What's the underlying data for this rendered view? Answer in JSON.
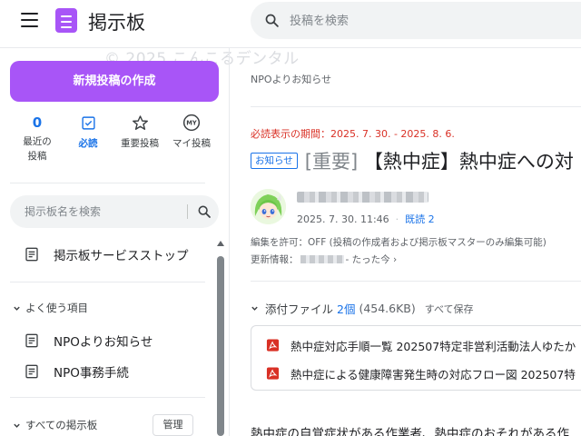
{
  "header": {
    "app_title": "掲示板",
    "search_placeholder": "投稿を検索",
    "watermark": "© 2025 こんこるデンタル",
    "icons": {
      "menu": "hamburger-menu-icon",
      "logo": "notepad-icon",
      "search": "search-icon"
    },
    "accent_color": "#a855f7"
  },
  "sidebar": {
    "new_post_label": "新規投稿の作成",
    "tiles": [
      {
        "label_line1": "最近の",
        "label_line2": "投稿",
        "count": "0",
        "icon": "count"
      },
      {
        "label": "必読",
        "icon": "checkbox-icon",
        "active": true
      },
      {
        "label": "重要投稿",
        "icon": "star-icon"
      },
      {
        "label": "マイ投稿",
        "icon": "my-badge-icon",
        "badge_text": "MY"
      }
    ],
    "board_search_placeholder": "掲示板名を検索",
    "service_stop": "掲示板サービスストップ",
    "favorites_header": "よく使う項目",
    "favorites": [
      "NPOよりお知らせ",
      "NPO事務手続"
    ],
    "all_boards_header": "すべての掲示板",
    "manage_label": "管理"
  },
  "main": {
    "breadcrumb": "NPOよりお知らせ",
    "required_period": "必読表示の期間：2025. 7. 30. - 2025. 8. 6.",
    "tag": "お知らせ",
    "title_important": "[重要]",
    "title_text": "【熱中症】熱中症への対",
    "post_datetime": "2025. 7. 30. 11:46",
    "read_label": "既読 2",
    "edit_permission": "編集を許可：OFF (投稿の作成者および掲示板マスターのみ編集可能)",
    "update_prefix": "更新情報：",
    "update_suffix": "- たった今 ›",
    "attachments": {
      "label": "添付ファイル",
      "count": "2個",
      "total_size": "(454.6KB)",
      "save_all": "すべて保存",
      "files": [
        "熱中症対応手順一覧 202507特定非営利活動法人ゆたか",
        "熱中症による健康障害発生時の対応フロー図 202507特"
      ]
    },
    "body_start": "熱中症の自覚症状がある作業者、熱中症のおそれがある作"
  }
}
